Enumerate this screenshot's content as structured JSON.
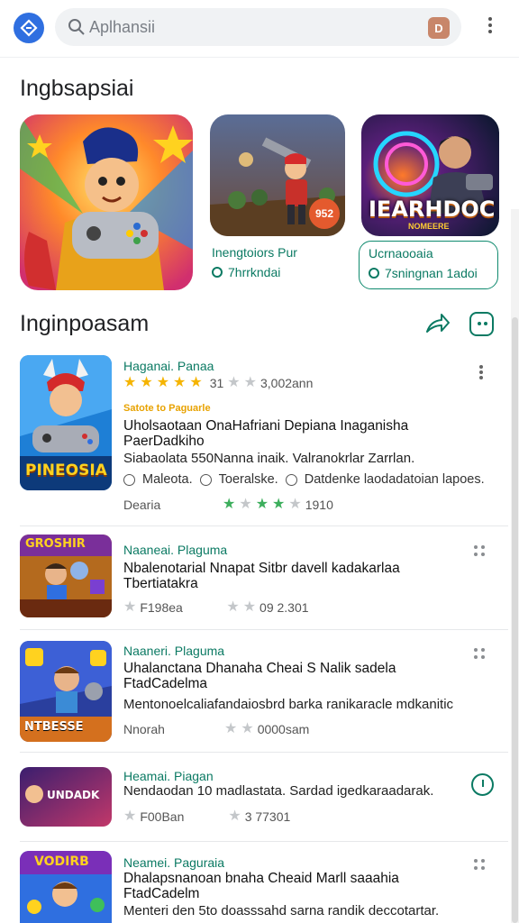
{
  "search": {
    "placeholder": "Aplhansii",
    "badge": "D"
  },
  "featured": {
    "title": "Ingbsapsiai",
    "tiles": [
      {
        "name": "Inengtoiors Pur",
        "meta": "7hrrkndai",
        "score": "952"
      },
      {
        "name": "Ucrnaooaia",
        "meta": "7sningnan 1adoi",
        "logo": "IEARHDOC",
        "logo_sub": "NOMEERE"
      }
    ]
  },
  "list_section": {
    "title": "Inginpoasam",
    "items": [
      {
        "category": "Haganai. Panaa",
        "rating_num": "31",
        "downloads": "3,002ann",
        "badge": "Satote to Paguarle",
        "title": "Uholsaotaan OnaHafriani Depiana Inaganisha PaerDadkiho",
        "desc": "Siabaolata 550Nanna inaik. Valranokrlar Zarrlan.",
        "tags": [
          "Maleota.",
          "Toeralske.",
          "Datdenke laodadatoian lapoes."
        ],
        "foot_label": "Dearia",
        "foot_value": "1910",
        "thumb_text": "PINEOSIA"
      },
      {
        "category": "Naaneai. Plaguma",
        "title": "Nbalenotarial Nnapat Sitbr davell kadakarlaa Tbertiatakra",
        "rating_text": "F198ea",
        "rating_value": "09 2.301",
        "thumb_text": "GROSHIR"
      },
      {
        "category": "Naaneri. Plaguma",
        "title": "Uhalanctana Dhanaha Cheai S Nalik sadela FtadCadelma",
        "desc": "Mentonoelcaliafandaiosbrd barka ranikaracle mdkanitic",
        "rating_text": "Nnorah",
        "rating_value": "0000sam",
        "thumb_text": "NTBESSE"
      },
      {
        "category": "Heamai. Piagan",
        "desc": "Nendaodan 10 madlastata. Sardad igedkaraadarak.",
        "rating_text": "F00Ban",
        "rating_value": "3 77301",
        "thumb_text": "UNDADK"
      },
      {
        "category": "Neamei. Paguraia",
        "title": "Dhalapsnanoan bnaha Cheaid Marll saaahia FtadCadelm",
        "desc": "Menteri den 5to doasssahd sarna randik deccotartar.",
        "thumb_text": "VODIRB"
      }
    ]
  },
  "colors": {
    "accent": "#0b7a63",
    "logo_blue": "#2f6fe0",
    "star_gold": "#f5b400"
  },
  "icons": [
    "app-logo-icon",
    "search-icon",
    "more-vert-icon",
    "share-icon",
    "emoji-face-icon",
    "download-icon",
    "info-icon",
    "grid-dots-icon"
  ]
}
